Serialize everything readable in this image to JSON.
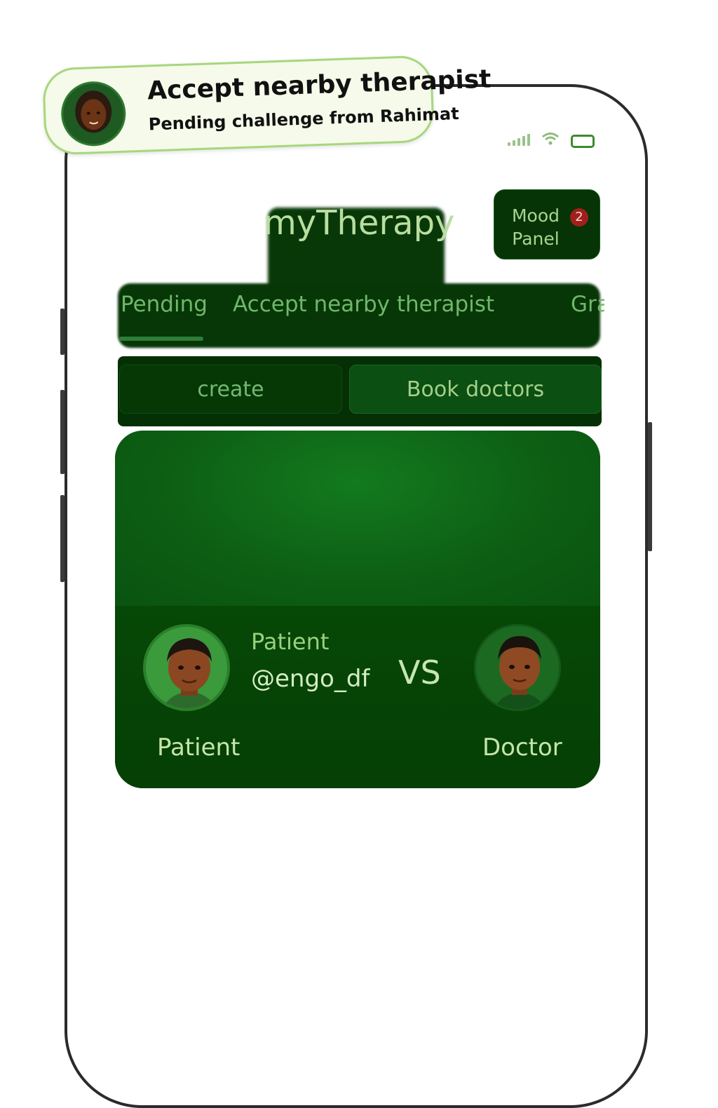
{
  "notification": {
    "title": "Accept nearby therapist",
    "subtitle": "Pending challenge from Rahimat",
    "avatar_icon": "woman-avatar-icon"
  },
  "status_bar": {
    "signal_icon": "signal-icon",
    "wifi_icon": "wifi-icon",
    "battery_icon": "battery-icon"
  },
  "header": {
    "app_title": "myTherapy",
    "mood_panel": {
      "label": "Mood\nPanel",
      "badge_count": "2"
    }
  },
  "tabs": [
    {
      "label": "Pending",
      "active": true
    },
    {
      "label": "Accept nearby therapist",
      "active": false
    },
    {
      "label": "Gra",
      "active": false
    }
  ],
  "actions": {
    "create_label": "create",
    "book_label": "Book doctors"
  },
  "match_card": {
    "left_role": "Patient",
    "handle": "@engo_df",
    "versus": "VS",
    "left_caption": "Patient",
    "right_caption": "Doctor"
  },
  "colors": {
    "accent_dark_green": "#063406",
    "card_green": "#0f5f17",
    "text_light_green": "#b9dea0",
    "badge_red": "#a01f1c",
    "notification_border": "#a7d77c"
  }
}
